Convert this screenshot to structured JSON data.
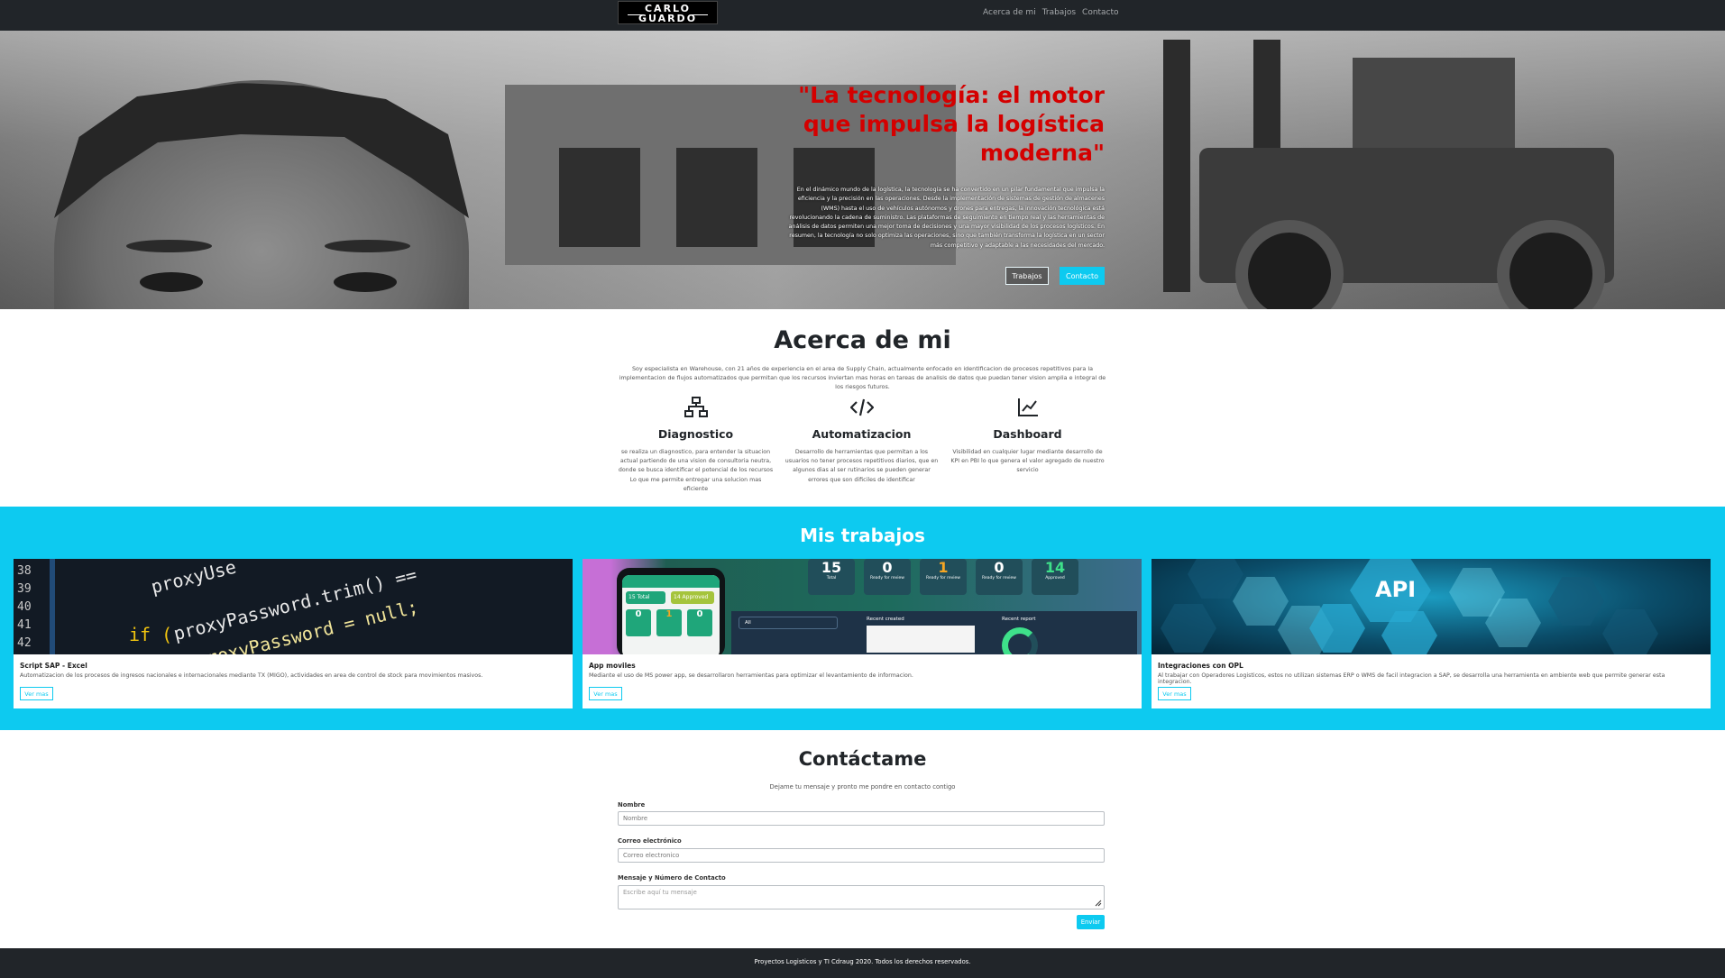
{
  "navbar": {
    "logo_line1": "CARLO",
    "logo_line2": "GUARDO",
    "links": [
      "Acerca de mi",
      "Trabajos",
      "Contacto"
    ]
  },
  "hero": {
    "title": "\"La tecnología: el motor que impulsa la logística moderna\"",
    "text": "En el dinámico mundo de la logística, la tecnología se ha convertido en un pilar fundamental que impulsa la eficiencia y la precisión en las operaciones. Desde la implementación de sistemas de gestión de almacenes (WMS) hasta el uso de vehículos autónomos y drones para entregas, la innovación tecnológica está revolucionando la cadena de suministro. Las plataformas de seguimiento en tiempo real y las herramientas de análisis de datos permiten una mejor toma de decisiones y una mayor visibilidad de los procesos logísticos. En resumen, la tecnología no solo optimiza las operaciones, sino que también transforma la logística en un sector más competitivo y adaptable a las necesidades del mercado.",
    "btn_works": "Trabajos",
    "btn_contact": "Contacto"
  },
  "about": {
    "title": "Acerca de mi",
    "text": "Soy especialista en Warehouse, con 21 años de experiencia en el area de Supply Chain, actualmente enfocado en identificacion de procesos repetitivos para la implementacion de flujos automatizados que permitan que los recursos inviertan mas horas en tareas de analisis de datos que puedan tener vision amplia e integral de los riesgos futuros.",
    "features": [
      {
        "icon": "sitemap-icon",
        "title": "Diagnostico",
        "text": "se realiza un diagnostico, para entender la situacion actual partiendo de una vision de consultoria neutra, donde se busca identificar el potencial de los recursos Lo que me permite entregar una solucion mas eficiente"
      },
      {
        "icon": "code-icon",
        "title": "Automatizacion",
        "text": "Desarrollo de herramientas que permitan a los usuarios no tener procesos repetitivos diarios, que en algunos dias al ser rutinarios se pueden generar errores que son dificiles de identificar"
      },
      {
        "icon": "chart-line-icon",
        "title": "Dashboard",
        "text": "Visibilidad en cualquier lugar mediante desarrollo de KPI en PBI lo que genera el valor agregado de nuestro servicio"
      }
    ]
  },
  "works": {
    "title": "Mis trabajos",
    "cards": [
      {
        "title": "Script SAP - Excel",
        "text": "Automatizacion de los procesos de ingresos nacionales e internacionales mediante TX (MIGO), actividades en area de control de stock para movimientos masivos.",
        "button": "Ver mas",
        "code1": "proxyUse",
        "code2": "proxyPassword.trim() ==",
        "code3": "proxyPassword = null;"
      },
      {
        "title": "App moviles",
        "text": "Mediante el uso de MS power app, se desarrollaron herramientas para optimizar el levantamiento de informacion.",
        "button": "Ver mas",
        "phone_tiles": [
          "0",
          "1",
          "0"
        ],
        "phone_total": "15 Total",
        "phone_approved": "14 Approved",
        "kpis": [
          {
            "v": "15",
            "l": "Total"
          },
          {
            "v": "0",
            "l": "Ready for review"
          },
          {
            "v": "1",
            "l": "Ready for review"
          },
          {
            "v": "0",
            "l": "Ready for review"
          },
          {
            "v": "14",
            "l": "Approved"
          }
        ],
        "panel_left": "Recent created",
        "panel_right": "Recent report",
        "panel_all": "All"
      },
      {
        "title": "Integraciones con OPL",
        "text": "Al trabajar con Operadores Logisticos, estos no utilizan sistemas ERP o WMS de facil integracion a SAP, se desarrolla una herramienta en ambiente web que permite generar esta integracion.",
        "button": "Ver mas",
        "api_label": "API"
      }
    ]
  },
  "contact": {
    "title": "Contáctame",
    "subtitle": "Dejame tu mensaje y pronto me pondre en contacto contigo",
    "name_label": "Nombre",
    "name_placeholder": "Nombre",
    "email_label": "Correo electrónico",
    "email_placeholder": "Correo electronico",
    "message_label": "Mensaje y Número de Contacto",
    "message_placeholder": "Escribe aquí tu mensaje",
    "send": "Enviar"
  },
  "footer": {
    "text": "Proyectos Logisticos y TI Cdraug 2020. Todos los derechos reservados."
  },
  "colors": {
    "navbar": "#212529",
    "accent": "#0dcaf0",
    "hero_title": "#d40000"
  }
}
